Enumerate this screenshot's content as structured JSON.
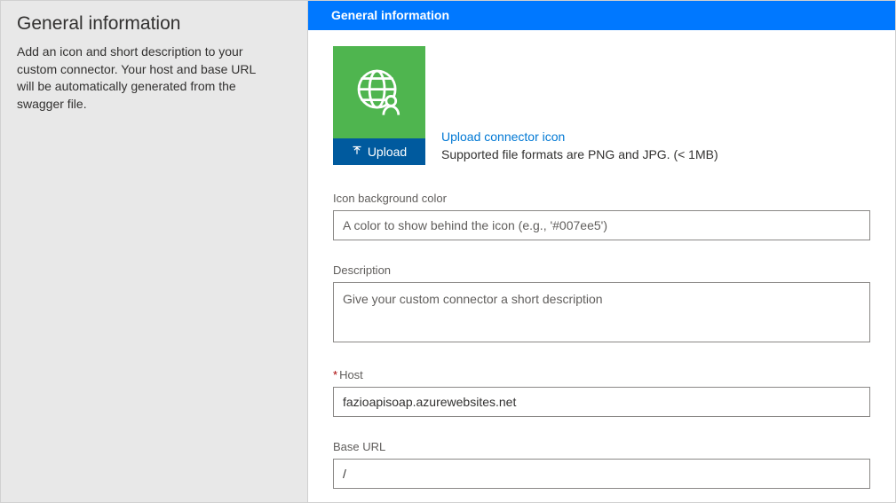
{
  "sidebar": {
    "title": "General information",
    "description": "Add an icon and short description to your custom connector. Your host and base URL will be automatically generated from the swagger file."
  },
  "header": {
    "title": "General information"
  },
  "iconSection": {
    "uploadButton": "Upload",
    "uploadLink": "Upload connector icon",
    "uploadHint": "Supported file formats are PNG and JPG. (< 1MB)",
    "iconBg": "#4fb54f"
  },
  "fields": {
    "iconBgColor": {
      "label": "Icon background color",
      "value": "",
      "placeholder": "A color to show behind the icon (e.g., '#007ee5')"
    },
    "description": {
      "label": "Description",
      "value": "",
      "placeholder": "Give your custom connector a short description"
    },
    "host": {
      "label": "Host",
      "required": "*",
      "value": "fazioapisoap.azurewebsites.net",
      "placeholder": ""
    },
    "baseUrl": {
      "label": "Base URL",
      "value": "/",
      "placeholder": ""
    }
  }
}
